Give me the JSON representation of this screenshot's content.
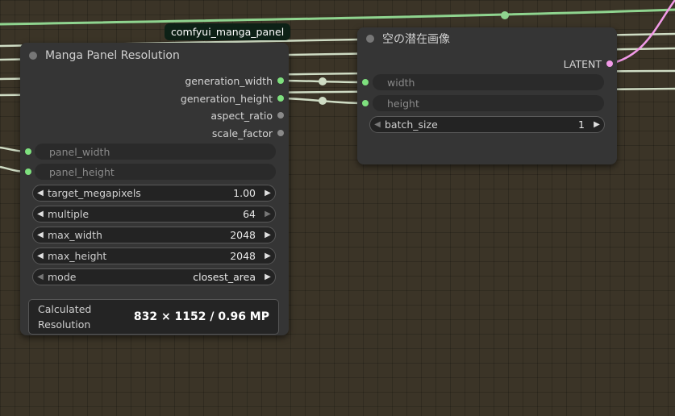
{
  "group_tag": "comfyui_manga_panel",
  "colors": {
    "canvas": "#3b3427",
    "node_bg": "#353535",
    "wire_green": "#8fd48f",
    "wire_pale": "#cfdcc4",
    "wire_pink": "#f29ae8",
    "slot_green": "#7ee07e",
    "slot_gray": "#8a8a8a",
    "slot_pink": "#f29ae8"
  },
  "manga_node": {
    "title": "Manga Panel Resolution",
    "outputs": [
      {
        "label": "generation_width",
        "connected": true
      },
      {
        "label": "generation_height",
        "connected": true
      },
      {
        "label": "aspect_ratio",
        "connected": false
      },
      {
        "label": "scale_factor",
        "connected": false
      }
    ],
    "inputs": [
      {
        "label": "panel_width"
      },
      {
        "label": "panel_height"
      }
    ],
    "widgets": [
      {
        "label": "target_megapixels",
        "value": "1.00",
        "left_enabled": true,
        "right_enabled": true
      },
      {
        "label": "multiple",
        "value": "64",
        "left_enabled": true,
        "right_enabled": false
      },
      {
        "label": "max_width",
        "value": "2048",
        "left_enabled": true,
        "right_enabled": true
      },
      {
        "label": "max_height",
        "value": "2048",
        "left_enabled": true,
        "right_enabled": true
      },
      {
        "label": "mode",
        "value": "closest_area",
        "left_enabled": false,
        "right_enabled": true
      }
    ],
    "result": {
      "label_line1": "Calculated",
      "label_line2": "Resolution",
      "value": "832 × 1152 / 0.96 MP"
    }
  },
  "latent_node": {
    "title": "空の潜在画像",
    "output": "LATENT",
    "inputs": [
      {
        "label": "width"
      },
      {
        "label": "height"
      }
    ],
    "widget": {
      "label": "batch_size",
      "value": "1",
      "left_enabled": false,
      "right_enabled": true
    }
  }
}
